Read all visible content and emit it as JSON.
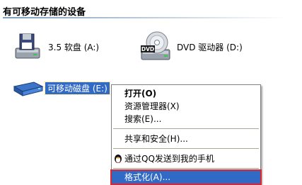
{
  "section_title": "有可移动存储的设备",
  "drives": [
    {
      "label": "3.5 软盘 (A:)",
      "icon": "floppy-drive-icon"
    },
    {
      "label": "DVD 驱动器 (D:)",
      "icon": "dvd-drive-icon",
      "icon_text": "DVD"
    },
    {
      "label": "可移动磁盘 (E:)",
      "icon": "removable-disk-icon",
      "selected": true
    }
  ],
  "context_menu": {
    "items": [
      {
        "label": "打开(O)",
        "bold": true
      },
      {
        "label": "资源管理器(X)"
      },
      {
        "label": "搜索(E)..."
      },
      {
        "label": "共享和安全(H)..."
      },
      {
        "label": "通过QQ发送到我的手机",
        "icon": "qq-penguin-icon"
      },
      {
        "label": "格式化(A)...",
        "highlighted": true
      }
    ]
  },
  "colors": {
    "selection": "#316ac5",
    "highlight_border": "#e0262a",
    "menu_border": "#808080"
  }
}
